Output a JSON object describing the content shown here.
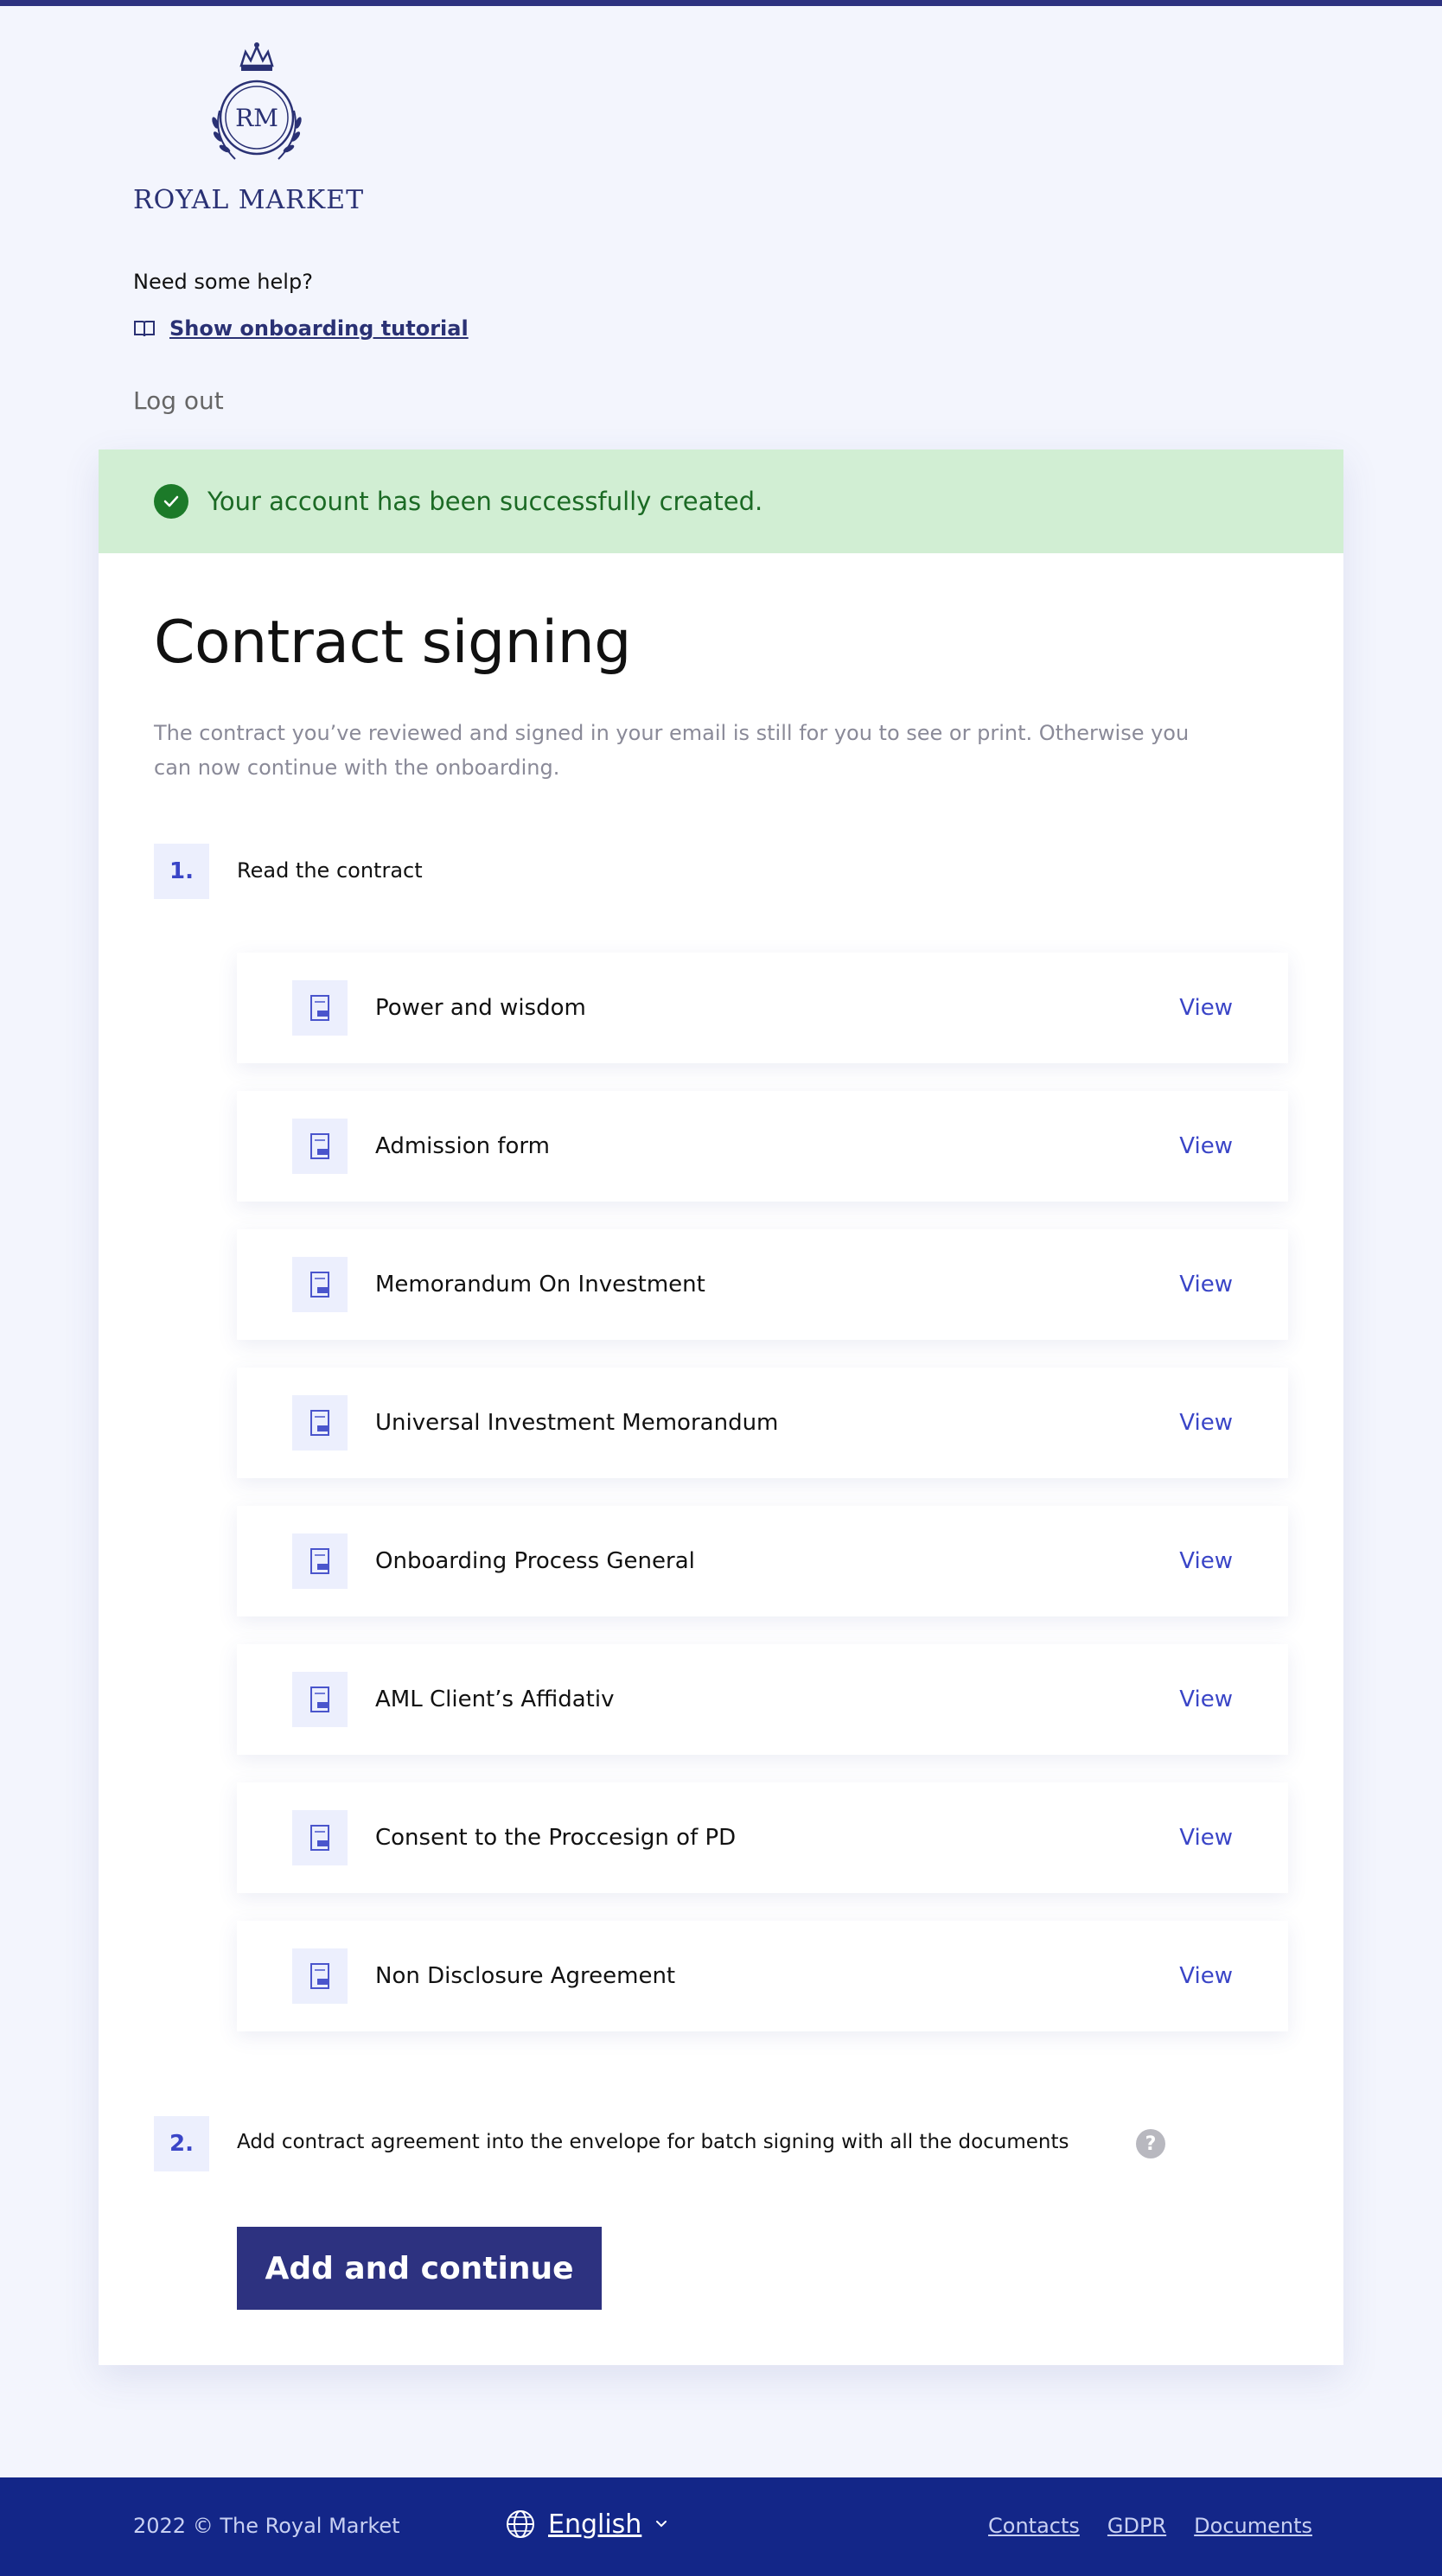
{
  "header": {
    "logo_monogram": "RM",
    "brand_name": "ROYAL MARKET",
    "help_title": "Need some help?",
    "tutorial_link": "Show onboarding tutorial",
    "logout": "Log out"
  },
  "alert": {
    "message": "Your account has been successfully created.",
    "color": "#1c7a29"
  },
  "main": {
    "title": "Contract signing",
    "description": "The contract you’ve reviewed and signed in your email is still for you to see or print. Otherwise you can now continue with the onboarding.",
    "steps": [
      {
        "number": "1.",
        "label": "Read the contract"
      },
      {
        "number": "2.",
        "label": "Add contract agreement into the envelope for batch signing with all the documents"
      }
    ],
    "view_label": "View",
    "documents": [
      {
        "name": "Power and wisdom"
      },
      {
        "name": "Admission form"
      },
      {
        "name": "Memorandum On Investment"
      },
      {
        "name": "Universal Investment Memorandum"
      },
      {
        "name": "Onboarding Process General"
      },
      {
        "name": "AML Client’s Affidativ"
      },
      {
        "name": "Consent to the Proccesign of PD"
      },
      {
        "name": "Non Disclosure Agreement"
      }
    ],
    "help_icon_glyph": "?",
    "cta_label": "Add and continue"
  },
  "footer": {
    "copyright": "2022 © The Royal Market",
    "language": "English",
    "links": [
      "Contacts",
      "GDPR",
      "Documents"
    ]
  },
  "colors": {
    "brand_dark": "#2d3280",
    "accent": "#3a45c7",
    "footer_bg": "#132688",
    "success_bg": "#d1eed3"
  }
}
